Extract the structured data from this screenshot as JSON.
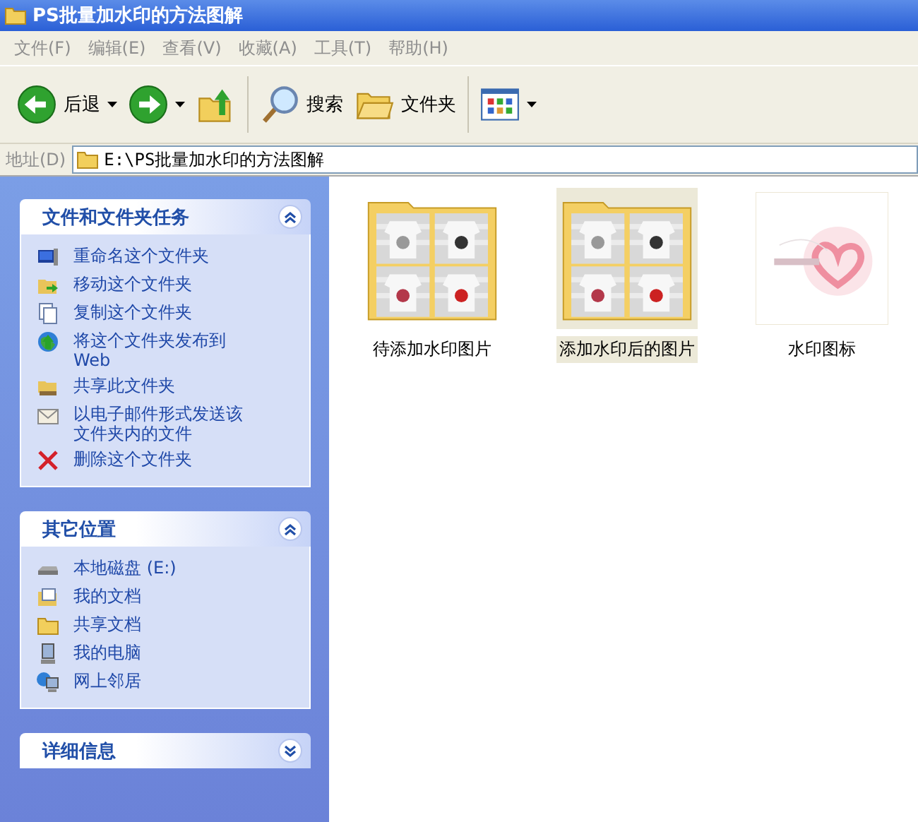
{
  "window": {
    "title": "PS批量加水印的方法图解"
  },
  "menu": [
    "文件(F)",
    "编辑(E)",
    "查看(V)",
    "收藏(A)",
    "工具(T)",
    "帮助(H)"
  ],
  "toolbar": [
    {
      "kind": "back",
      "label": "后退",
      "dropdown": true
    },
    {
      "kind": "forward",
      "dropdown": true
    },
    {
      "kind": "up"
    },
    {
      "kind": "search",
      "label": "搜索"
    },
    {
      "kind": "folders",
      "label": "文件夹"
    },
    {
      "kind": "views",
      "dropdown": true
    }
  ],
  "address": {
    "label": "地址(D)",
    "value": "E:\\PS批量加水印的方法图解"
  },
  "panels": [
    {
      "title": "文件和文件夹任务",
      "expanded": true,
      "items": [
        {
          "kind": "rename",
          "label": "重命名这个文件夹"
        },
        {
          "kind": "move",
          "label": "移动这个文件夹"
        },
        {
          "kind": "copy",
          "label": "复制这个文件夹"
        },
        {
          "kind": "publish",
          "label": "将这个文件夹发布到 Web"
        },
        {
          "kind": "share",
          "label": "共享此文件夹"
        },
        {
          "kind": "email",
          "label": "以电子邮件形式发送该文件夹内的文件"
        },
        {
          "kind": "delete",
          "label": "删除这个文件夹"
        }
      ]
    },
    {
      "title": "其它位置",
      "expanded": true,
      "items": [
        {
          "kind": "disk",
          "label": "本地磁盘 (E:)"
        },
        {
          "kind": "documents",
          "label": "我的文档"
        },
        {
          "kind": "folder",
          "label": "共享文档"
        },
        {
          "kind": "computer",
          "label": "我的电脑"
        },
        {
          "kind": "network",
          "label": "网上邻居"
        }
      ]
    },
    {
      "title": "详细信息",
      "expanded": false
    }
  ],
  "files": [
    {
      "name": "待添加水印图片",
      "kind": "folder",
      "selected": false
    },
    {
      "name": "添加水印后的图片",
      "kind": "folder",
      "selected": true
    },
    {
      "name": "水印图标",
      "selected": false
    }
  ]
}
